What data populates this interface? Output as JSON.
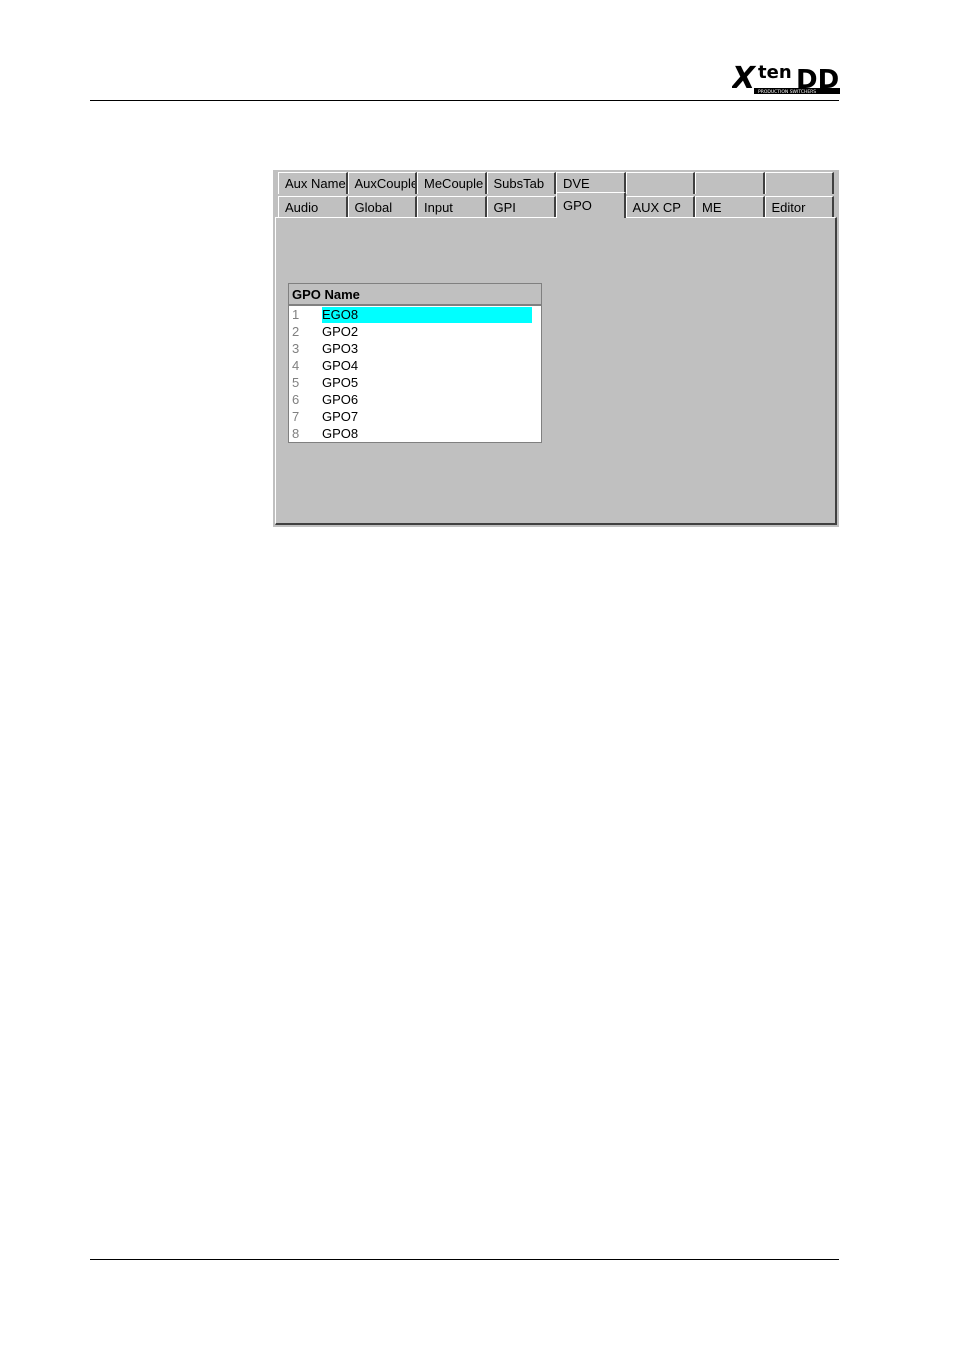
{
  "header": {
    "logo_text": "Xten DD",
    "logo_tagline": "PRODUCTION SWITCHERS"
  },
  "tabs_row1": [
    "Aux Name",
    "AuxCouple",
    "MeCouple",
    "SubsTab",
    "DVE",
    "",
    "",
    ""
  ],
  "tabs_row2": [
    "Audio",
    "Global",
    "Input",
    "GPI",
    "GPO",
    "AUX CP",
    "ME",
    "Editor"
  ],
  "active_tab": "GPO",
  "gpo_table": {
    "header": "GPO Name",
    "rows": [
      {
        "num": "1",
        "name": "EGO8",
        "selected": true
      },
      {
        "num": "2",
        "name": "GPO2"
      },
      {
        "num": "3",
        "name": "GPO3"
      },
      {
        "num": "4",
        "name": "GPO4"
      },
      {
        "num": "5",
        "name": "GPO5"
      },
      {
        "num": "6",
        "name": "GPO6"
      },
      {
        "num": "7",
        "name": "GPO7"
      },
      {
        "num": "8",
        "name": "GPO8"
      }
    ]
  },
  "colors": {
    "selection": "#00ffff",
    "panel": "#c0c0c0"
  }
}
